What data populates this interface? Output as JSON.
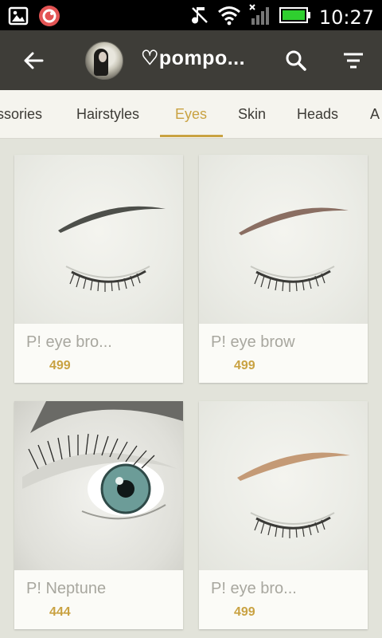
{
  "statusbar": {
    "time": "10:27"
  },
  "appbar": {
    "title": "♡pompo..."
  },
  "tabs": [
    {
      "label": "ssories"
    },
    {
      "label": "Hairstyles"
    },
    {
      "label": "Eyes"
    },
    {
      "label": "Skin"
    },
    {
      "label": "Heads"
    },
    {
      "label": "A"
    }
  ],
  "active_tab": "Eyes",
  "items": [
    {
      "name": "P! eye bro...",
      "price": "499"
    },
    {
      "name": "P! eye brow",
      "price": "499"
    },
    {
      "name": "P! Neptune",
      "price": "444"
    },
    {
      "name": "P! eye bro...",
      "price": "499"
    }
  ],
  "colors": {
    "accent": "#c9a242",
    "appbar": "#3e3d38",
    "tabbar": "#f5f4ee",
    "background": "#e2e3da"
  }
}
